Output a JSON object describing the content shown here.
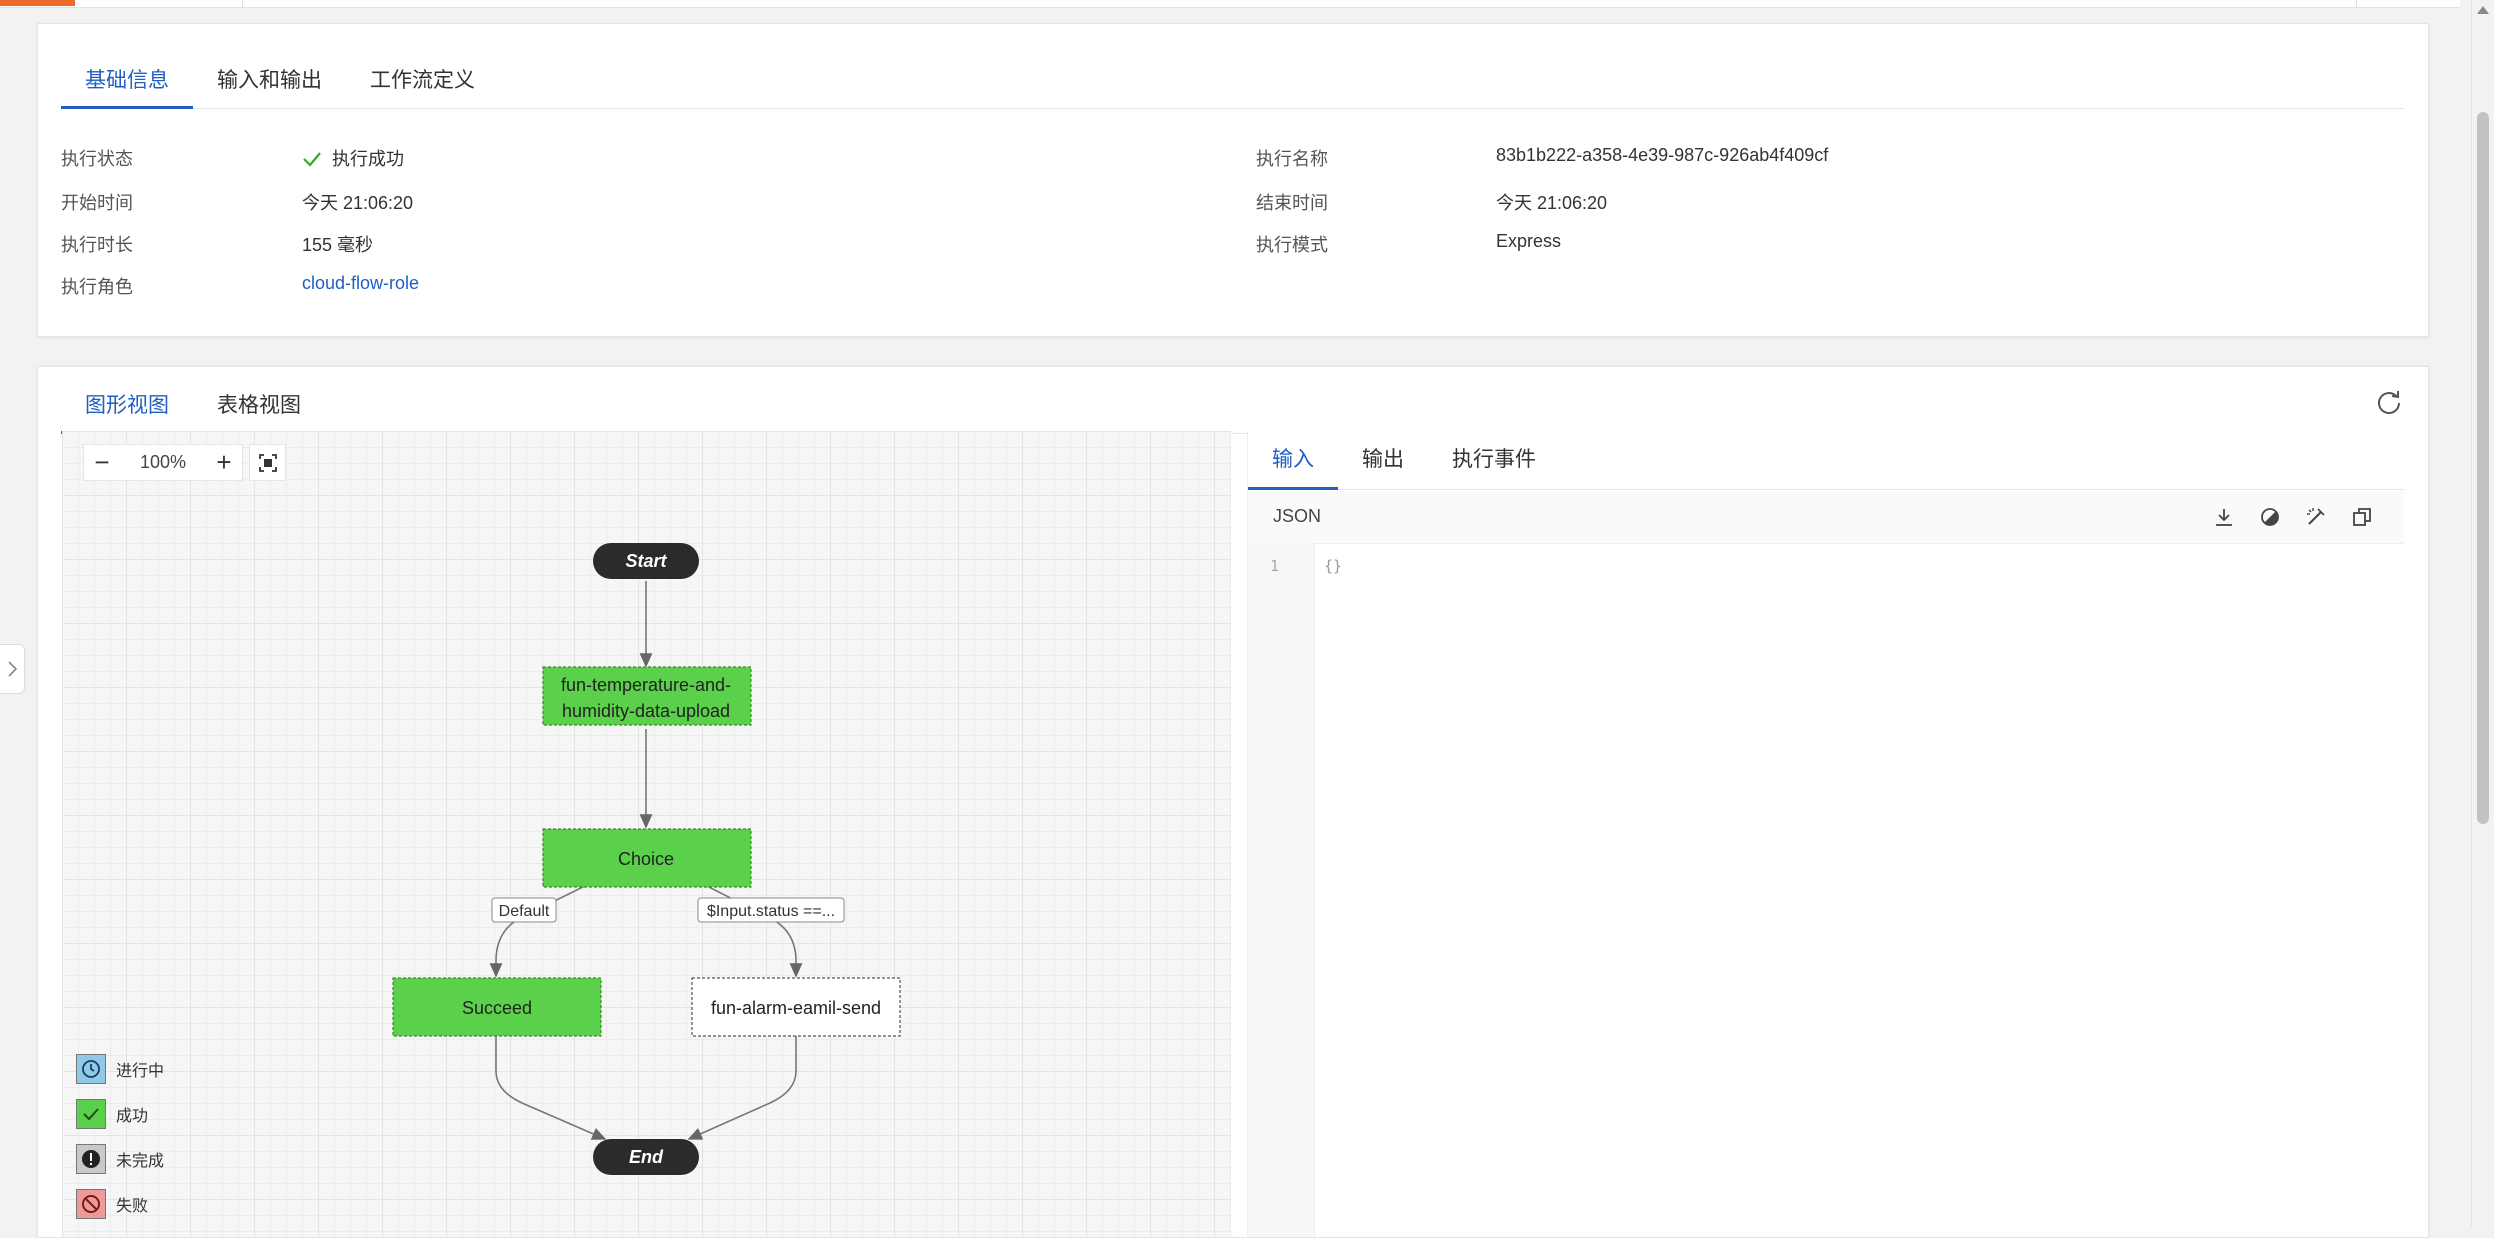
{
  "basic_tabs": [
    {
      "label": "基础信息",
      "active": true
    },
    {
      "label": "输入和输出",
      "active": false
    },
    {
      "label": "工作流定义",
      "active": false
    }
  ],
  "info": {
    "status_label": "执行状态",
    "status_value": "执行成功",
    "start_label": "开始时间",
    "start_value": "今天 21:06:20",
    "duration_label": "执行时长",
    "duration_value": "155 毫秒",
    "role_label": "执行角色",
    "role_value": "cloud-flow-role",
    "name_label": "执行名称",
    "name_value": "83b1b222-a358-4e39-987c-926ab4f409cf",
    "end_label": "结束时间",
    "end_value": "今天 21:06:20",
    "mode_label": "执行模式",
    "mode_value": "Express"
  },
  "view_tabs": [
    {
      "label": "图形视图",
      "active": true
    },
    {
      "label": "表格视图",
      "active": false
    }
  ],
  "graph": {
    "zoom": "100%",
    "zoom_out": "−",
    "zoom_in": "+",
    "nodes": {
      "start": "Start",
      "task_line1": "fun-temperature-and-",
      "task_line2": "humidity-data-upload",
      "choice": "Choice",
      "succeed": "Succeed",
      "alarm": "fun-alarm-eamil-send",
      "end": "End"
    },
    "edge_labels": {
      "default": "Default",
      "condition": "$Input.status ==..."
    },
    "legend": [
      {
        "label": "进行中",
        "color": "#8fc9e8",
        "icon": "clock-icon"
      },
      {
        "label": "成功",
        "color": "#5bd04a",
        "icon": "check-icon"
      },
      {
        "label": "未完成",
        "color": "#c9c9c9",
        "icon": "exclamation-icon"
      },
      {
        "label": "失败",
        "color": "#ee9a9a",
        "icon": "ban-icon"
      }
    ],
    "colors": {
      "success": "#5bd04a",
      "terminal": "#2b2b2b"
    }
  },
  "detail_tabs": [
    {
      "label": "输入",
      "active": true
    },
    {
      "label": "输出",
      "active": false
    },
    {
      "label": "执行事件",
      "active": false
    }
  ],
  "editor": {
    "title": "JSON",
    "line": "1",
    "content": "{}"
  },
  "accent": "#1f5fc4"
}
